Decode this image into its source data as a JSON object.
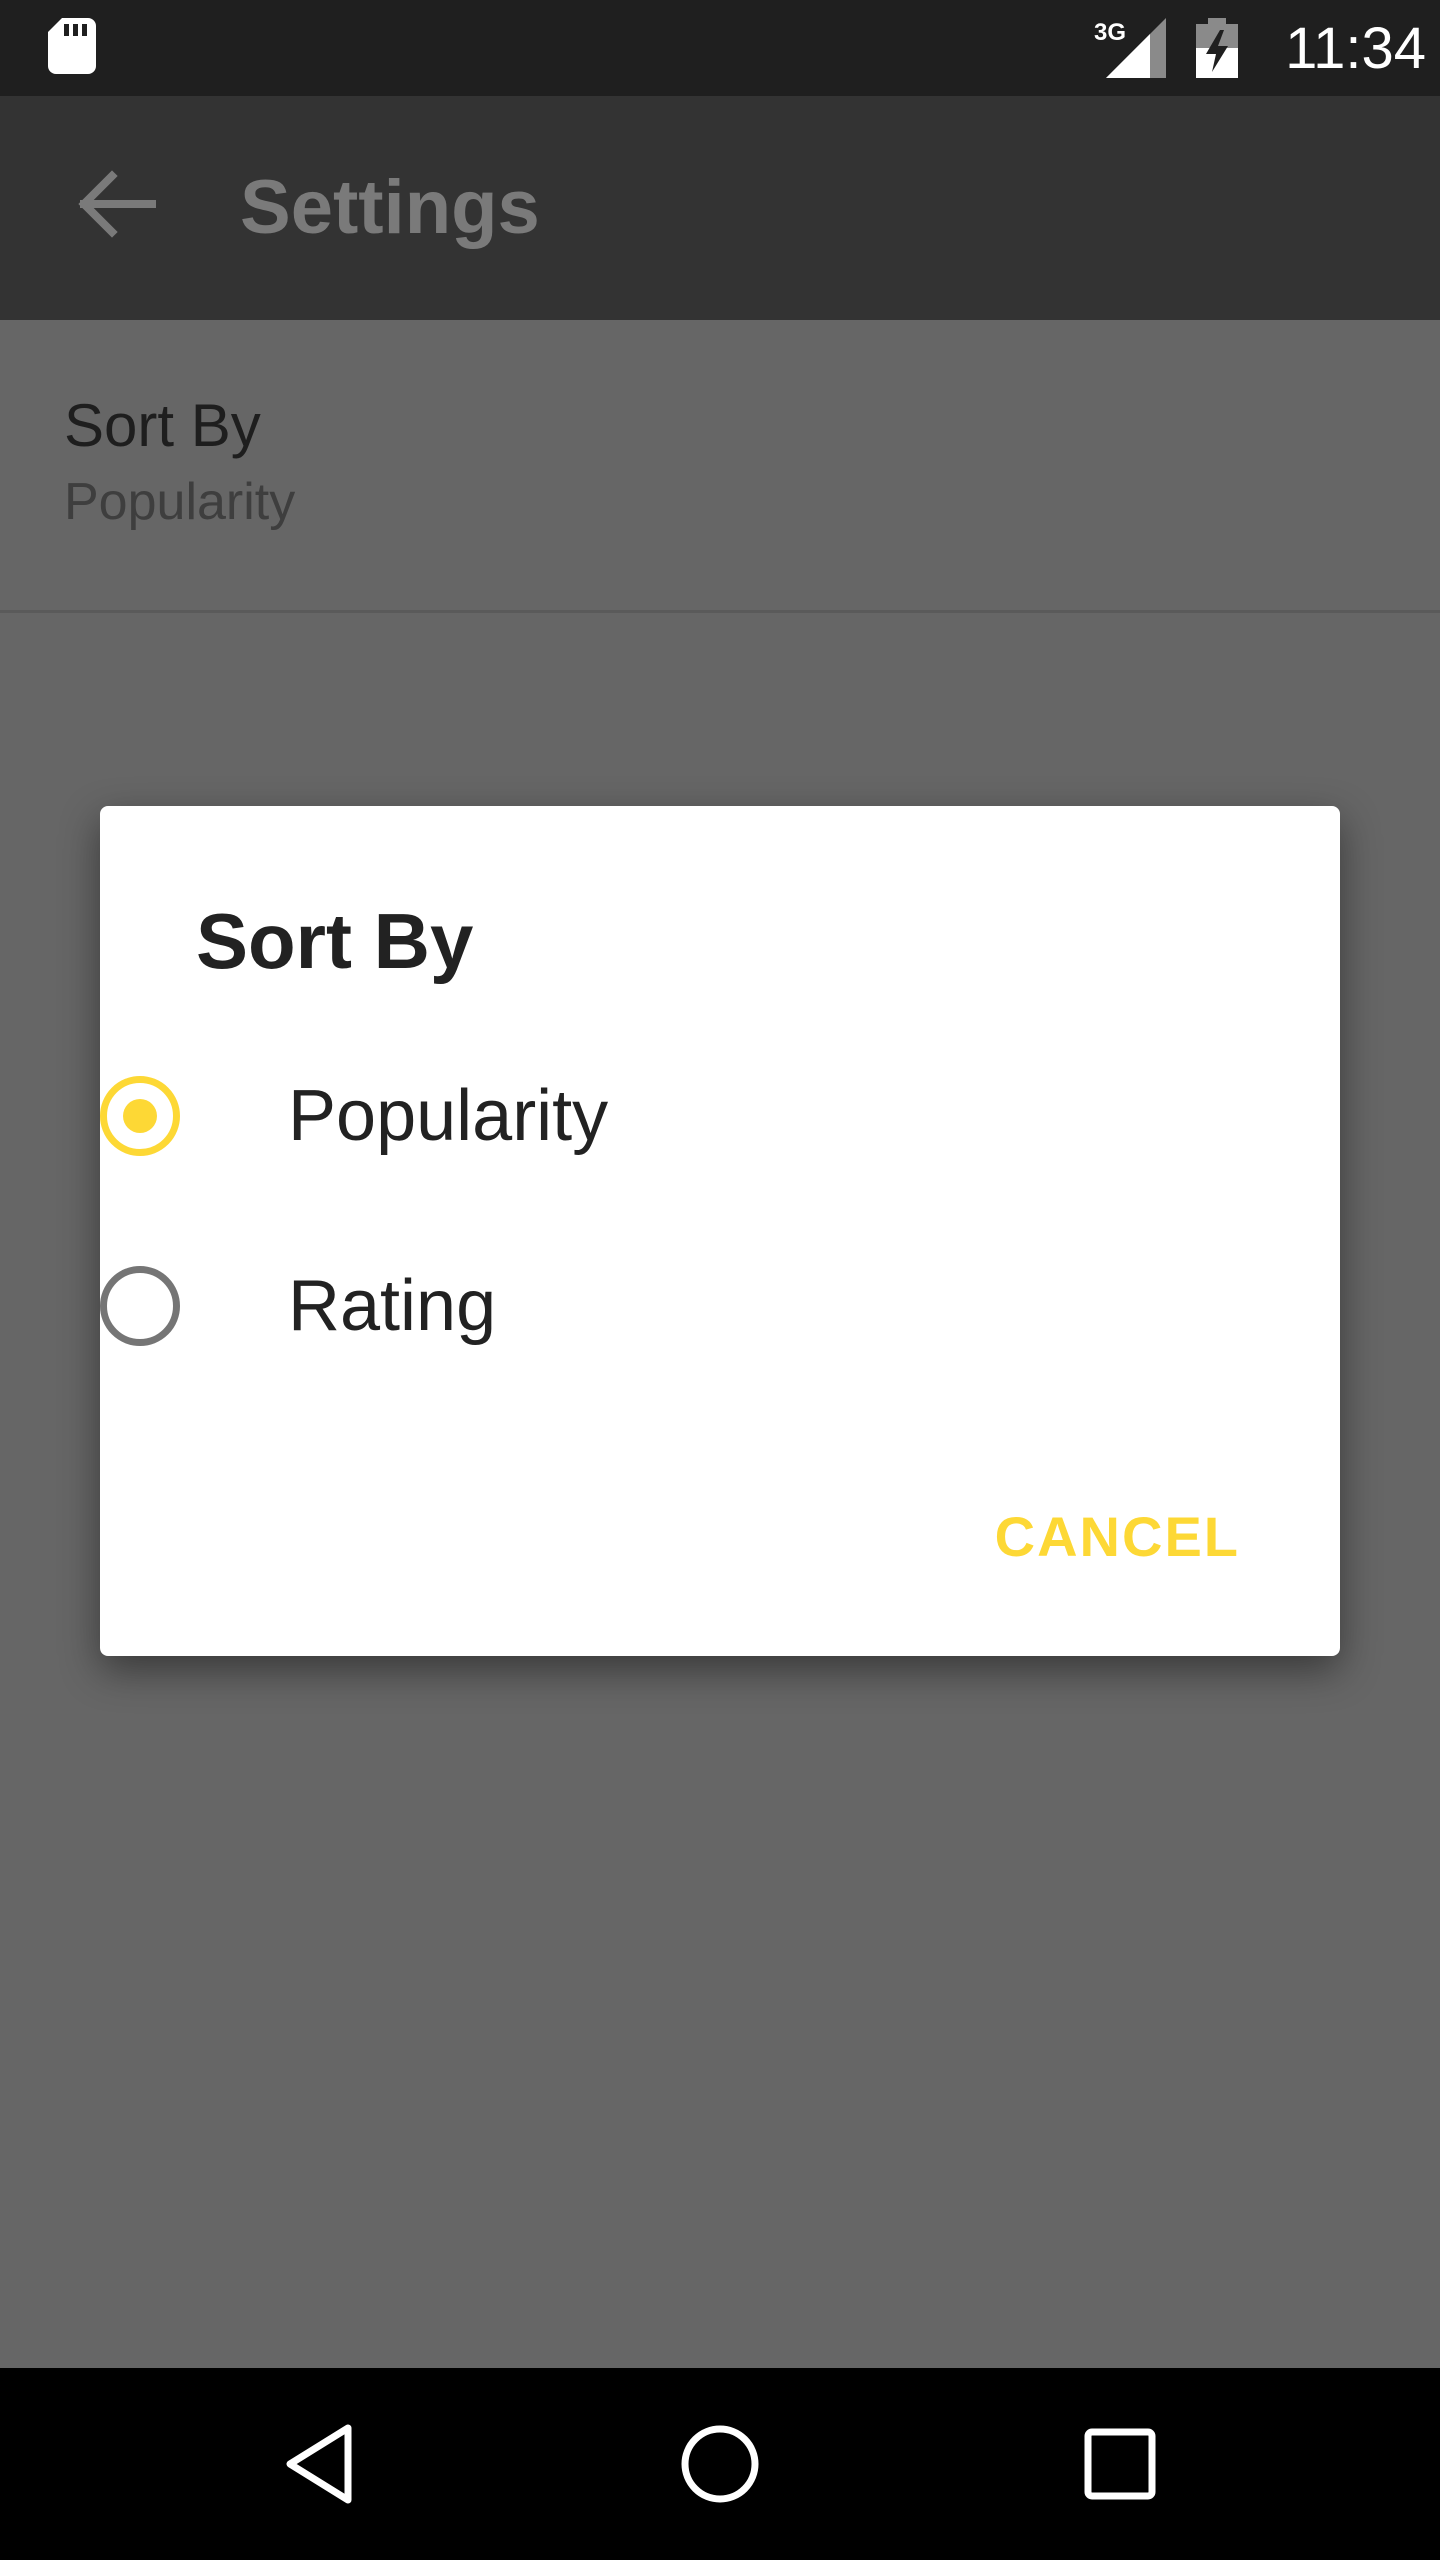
{
  "status_bar": {
    "time": "11:34",
    "network_type": "3G",
    "icons": [
      "sd-card-icon",
      "signal-3g-icon",
      "battery-charging-icon"
    ]
  },
  "app_bar": {
    "title": "Settings",
    "back_icon": "arrow-back-icon"
  },
  "preference": {
    "title": "Sort By",
    "summary": "Popularity"
  },
  "dialog": {
    "title": "Sort By",
    "options": [
      {
        "label": "Popularity",
        "selected": true
      },
      {
        "label": "Rating",
        "selected": false
      }
    ],
    "cancel_label": "CANCEL"
  },
  "nav_bar": {
    "icons": [
      "nav-back-icon",
      "nav-home-icon",
      "nav-recents-icon"
    ]
  },
  "colors": {
    "accent": "#fdd835",
    "scrim_background": "#666666",
    "app_bar": "#333333",
    "status_bar": "#1f1f1f"
  }
}
